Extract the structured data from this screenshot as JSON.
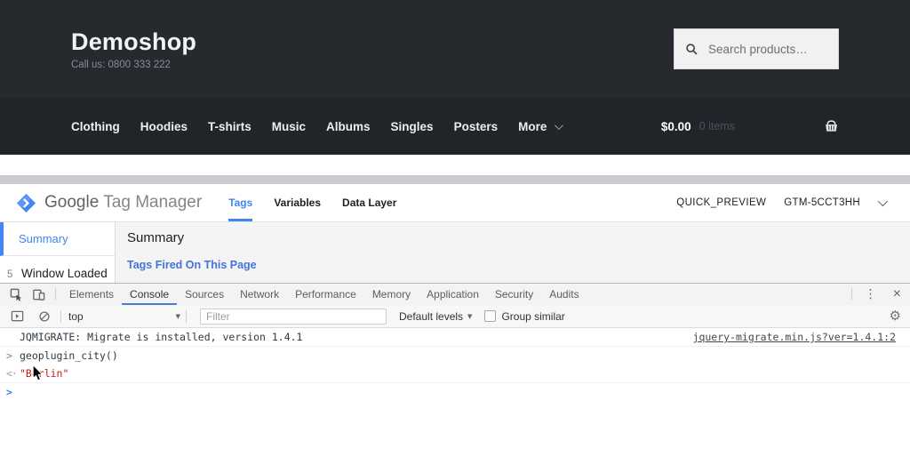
{
  "shop": {
    "title": "Demoshop",
    "tagline": "Call us: 0800 333 222",
    "search_placeholder": "Search products…",
    "nav": [
      "Clothing",
      "Hoodies",
      "T-shirts",
      "Music",
      "Albums",
      "Singles",
      "Posters",
      "More"
    ],
    "cart": {
      "total": "$0.00",
      "count": "0 items"
    }
  },
  "gtm": {
    "brand": {
      "google": "Google",
      "product": "Tag Manager"
    },
    "tabs": [
      {
        "label": "Tags"
      },
      {
        "label": "Variables"
      },
      {
        "label": "Data Layer"
      }
    ],
    "active_tab": "Tags",
    "preview_badge": "QUICK_PREVIEW",
    "container_id": "GTM-5CCT3HH",
    "sidebar": {
      "selected": "Summary",
      "event_index": "5",
      "event_label": "Window Loaded"
    },
    "main": {
      "heading": "Summary",
      "section_title": "Tags Fired On This Page"
    }
  },
  "devtools": {
    "tabs": [
      {
        "label": "Elements"
      },
      {
        "label": "Console"
      },
      {
        "label": "Sources"
      },
      {
        "label": "Network"
      },
      {
        "label": "Performance"
      },
      {
        "label": "Memory"
      },
      {
        "label": "Application"
      },
      {
        "label": "Security"
      },
      {
        "label": "Audits"
      }
    ],
    "active_tab": "Console",
    "toolbar": {
      "context": "top",
      "filter_placeholder": "Filter",
      "levels_label": "Default levels",
      "group_similar_label": "Group similar"
    },
    "console": {
      "log_text": "JQMIGRATE: Migrate is installed, version 1.4.1",
      "log_source": "jquery-migrate.min.js?ver=1.4.1:2",
      "command": "geoplugin_city()",
      "result": "\"Berlin\""
    }
  },
  "icons": {
    "gear": "⚙",
    "kebab": "⋮",
    "close": "×",
    "dropdown_arrow": "▼",
    "command_chevron": ">",
    "result_arrow": "<·",
    "prompt_chevron": ">"
  },
  "colors": {
    "header_dark": "#26292e",
    "nav_dark": "#212429",
    "gtm_accent_blue": "#4285f4",
    "devtools_active_blue": "#4a7bd0",
    "console_result_red": "#c41a16",
    "console_prompt_blue": "#2c7bf6"
  }
}
